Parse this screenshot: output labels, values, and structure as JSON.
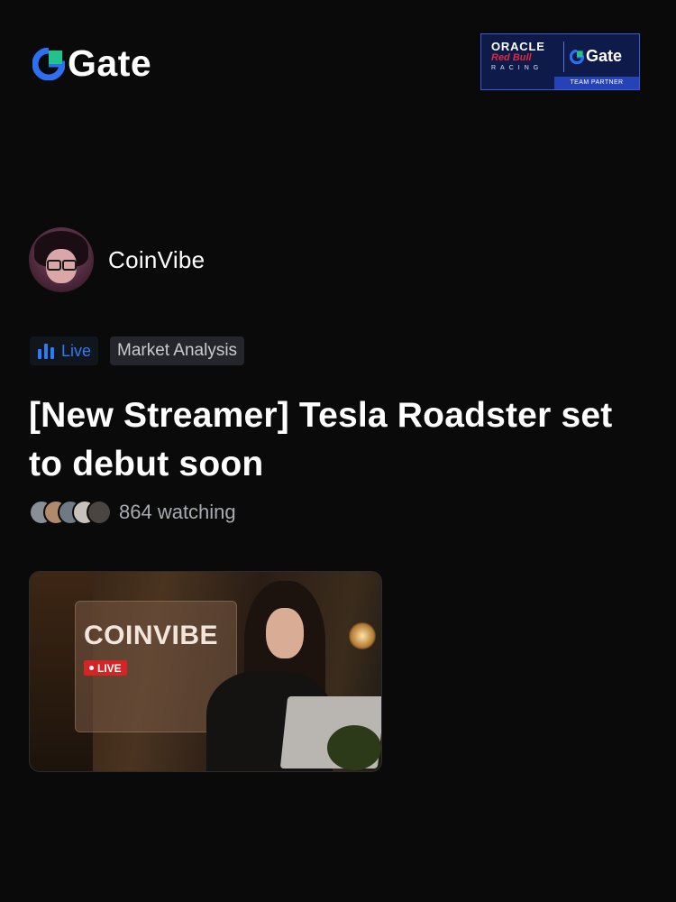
{
  "header": {
    "logo_text": "Gate",
    "partner_badge": {
      "line1": "ORACLE",
      "line2": "Red Bull",
      "line3": "RACING",
      "gate_text": "Gate",
      "footer": "TEAM PARTNER"
    }
  },
  "streamer": {
    "name": "CoinVibe"
  },
  "tags": {
    "live_label": "Live",
    "category": "Market Analysis"
  },
  "stream": {
    "title": "[New Streamer] Tesla Roadster set to debut soon",
    "viewers_text": "864 watching"
  },
  "thumbnail": {
    "brand_text": "COINVIBE",
    "live_badge": "LIVE"
  },
  "colors": {
    "background": "#0a0a0b",
    "accent_blue": "#2e7bf6",
    "live_red": "#d42424"
  },
  "icons": {
    "live": "bar-chart-icon",
    "logo": "gate-logo-icon"
  }
}
